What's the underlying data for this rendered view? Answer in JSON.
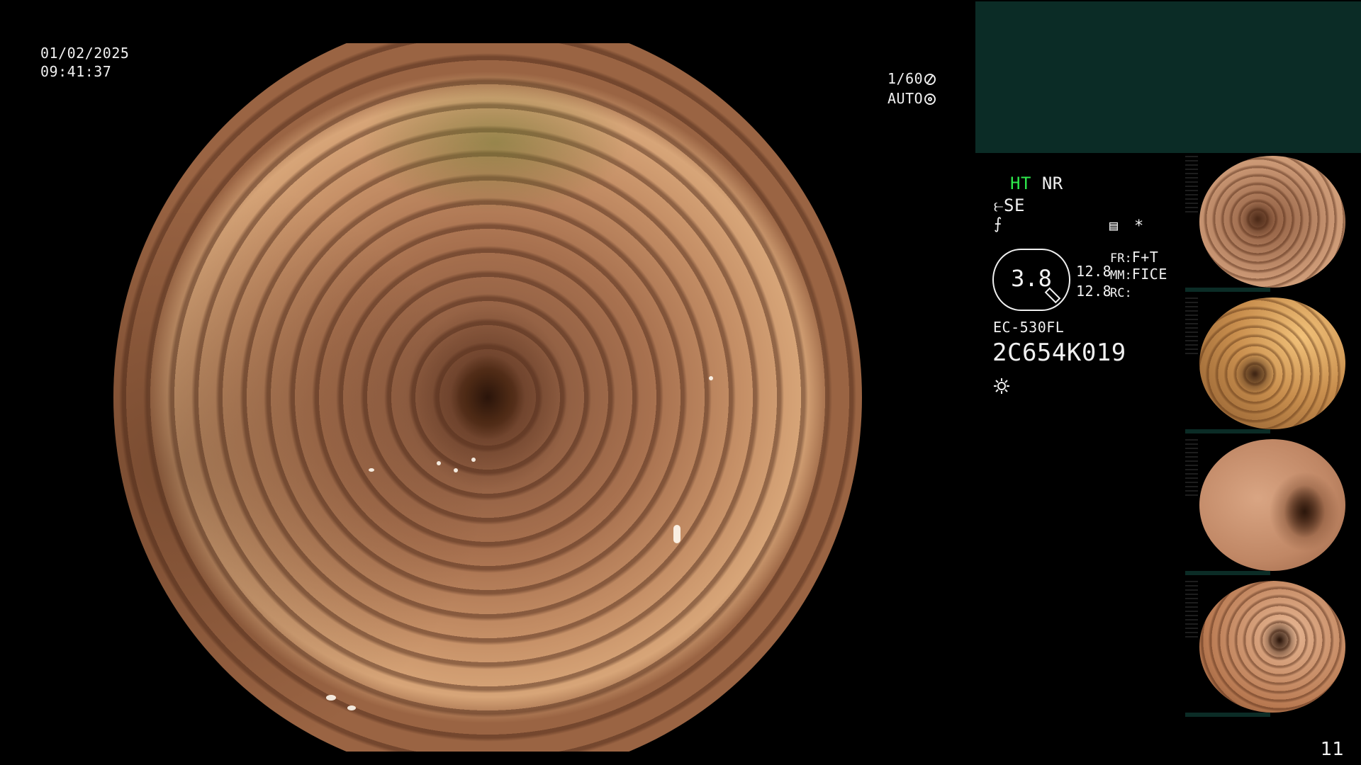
{
  "timestamp": {
    "date": "01/02/2025",
    "time": "09:41:37"
  },
  "camera": {
    "shutter": "1/60",
    "iris": "AUTO"
  },
  "processing": {
    "ht_label": "HT",
    "nr_label": "NR",
    "se_label": "SE",
    "fr_key": "FR:",
    "fr_value": "F+T",
    "mm_key": "MM:",
    "mm_value": "FICE",
    "rc_key": "RC:",
    "rc_value": "",
    "asterisk": "*"
  },
  "gauge": {
    "value": "3.8",
    "line1": "12.8",
    "line2": "12.8"
  },
  "scope": {
    "model": "EC-530FL",
    "serial": "2C654K019"
  },
  "thumbnails": [
    {
      "name": "thumbnail-1"
    },
    {
      "name": "thumbnail-2"
    },
    {
      "name": "thumbnail-3"
    },
    {
      "name": "thumbnail-4"
    }
  ],
  "page_number": "11",
  "colors": {
    "ht": "#2ee84c",
    "panel": "#0b2c26",
    "text": "#f0f0f0"
  }
}
